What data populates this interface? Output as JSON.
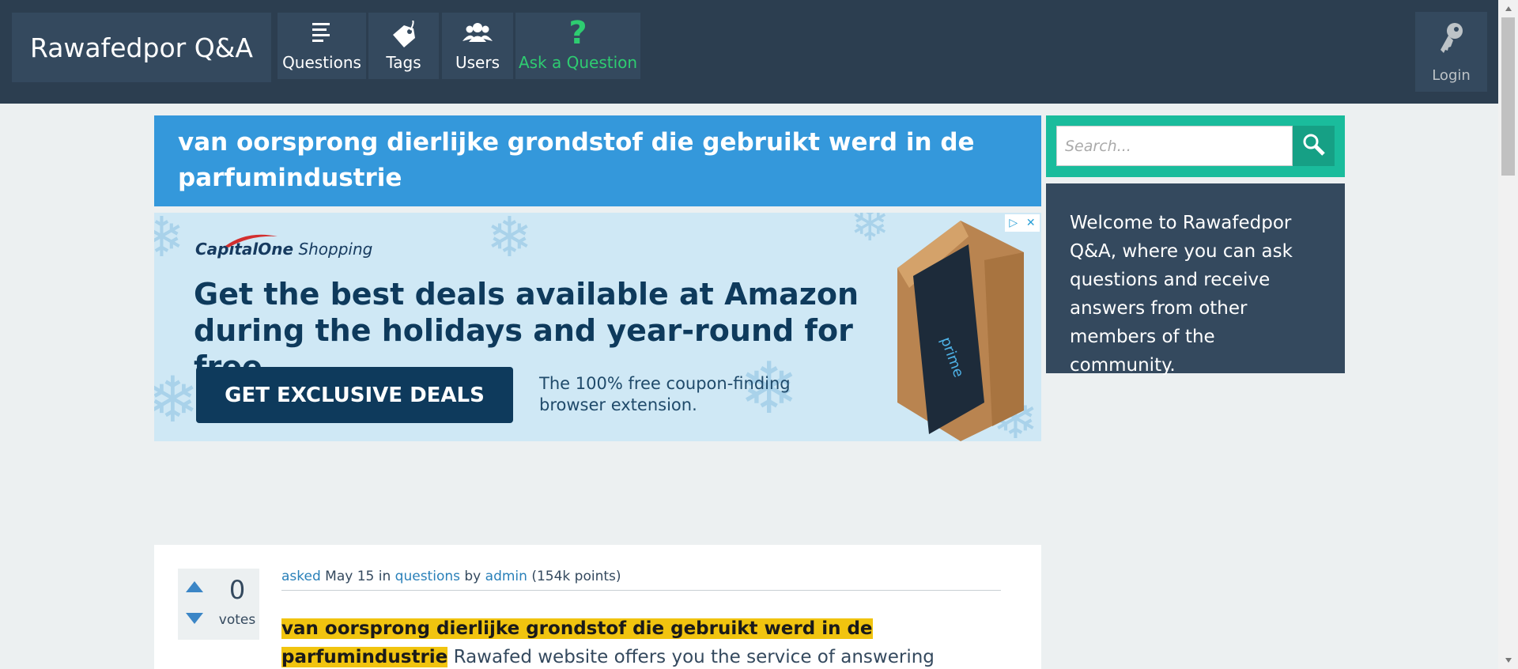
{
  "header": {
    "site_title": "Rawafedpor Q&A",
    "nav": {
      "questions": "Questions",
      "tags": "Tags",
      "users": "Users",
      "ask": "Ask a Question"
    },
    "login": "Login"
  },
  "question": {
    "title": "van oorsprong dierlijke grondstof die gebruikt werd in de parfumindustrie",
    "votes": "0",
    "votes_label": "votes",
    "meta": {
      "asked": "asked",
      "date": "May 15",
      "in": "in",
      "category": "questions",
      "by": "by",
      "author": "admin",
      "points": "(154k points)"
    },
    "body_highlight": "van oorsprong dierlijke grondstof die gebruikt werd in de parfumindustrie",
    "body_rest": "Rawafed website offers you the service of answering questions,"
  },
  "ad": {
    "brand_prefix": "Capital",
    "brand_one": "One",
    "brand_suffix": "Shopping",
    "headline": "Get the best deals available at Amazon during the holidays and year-round for free.",
    "cta": "GET EXCLUSIVE DEALS",
    "subtext": "The 100% free coupon-finding browser extension."
  },
  "sidebar": {
    "search_placeholder": "Search...",
    "welcome": "Welcome to Rawafedpor Q&A, where you can ask questions and receive answers from other members of the community."
  },
  "colors": {
    "topbar": "#2c3e50",
    "nav_button": "#34495e",
    "title_bg": "#3498db",
    "ask_accent": "#2ecc71",
    "search_bg": "#1abc9c",
    "highlight": "#f1c40f"
  }
}
